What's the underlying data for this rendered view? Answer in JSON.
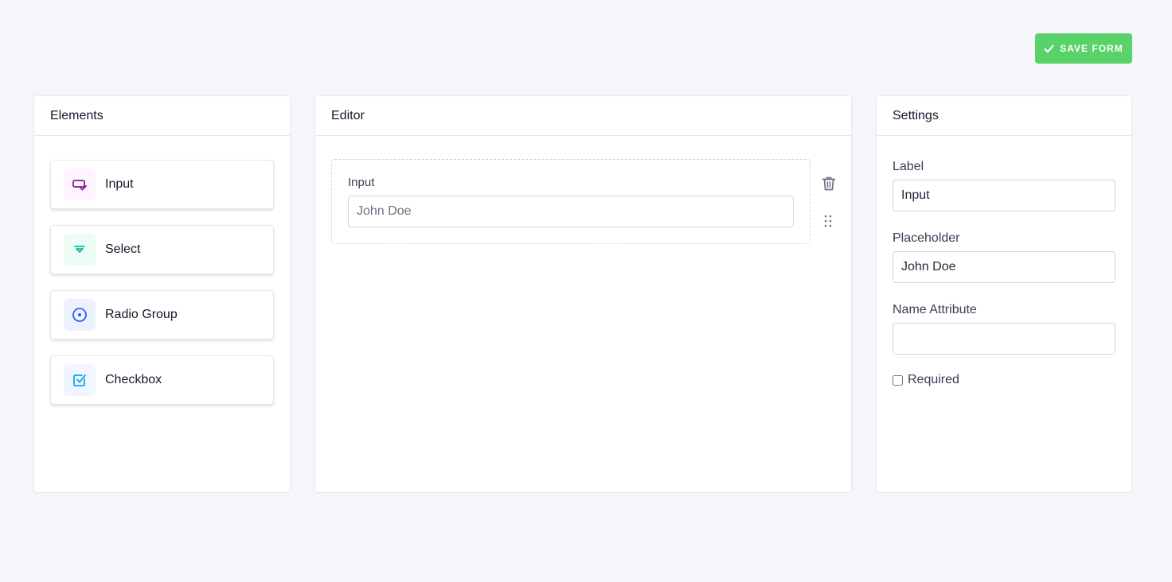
{
  "toolbar": {
    "save_label": "SAVE FORM",
    "save_color": "#5ad26a"
  },
  "elements_panel": {
    "title": "Elements",
    "items": [
      {
        "label": "Input",
        "icon": "input-icon",
        "icon_color": "#86198f",
        "icon_bg": "#fdf4ff"
      },
      {
        "label": "Select",
        "icon": "select-icon",
        "icon_color": "#14b8a6",
        "icon_bg": "#ecfdf5"
      },
      {
        "label": "Radio Group",
        "icon": "radio-icon",
        "icon_color": "#2563eb",
        "icon_bg": "#eef2ff"
      },
      {
        "label": "Checkbox",
        "icon": "checkbox-icon",
        "icon_color": "#0ea5e9",
        "icon_bg": "#eff6ff"
      }
    ]
  },
  "editor_panel": {
    "title": "Editor",
    "field": {
      "label": "Input",
      "placeholder": "John Doe"
    }
  },
  "settings_panel": {
    "title": "Settings",
    "label_label": "Label",
    "label_value": "Input",
    "placeholder_label": "Placeholder",
    "placeholder_value": "John Doe",
    "name_label": "Name Attribute",
    "name_value": "",
    "required_label": "Required",
    "required_checked": false
  }
}
